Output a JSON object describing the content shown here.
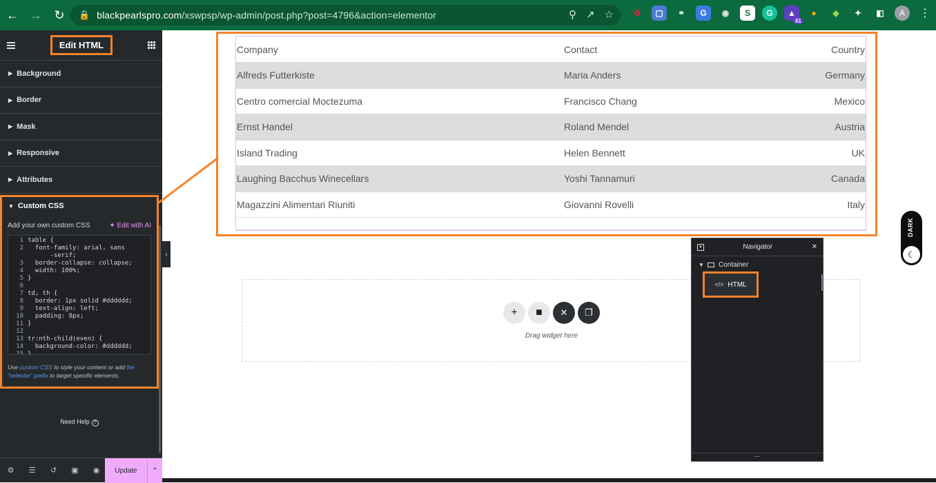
{
  "browser": {
    "url_host": "blackpearlspro.com",
    "url_path": "/xswpsp/wp-admin/post.php?post=4796&action=elementor",
    "extension_badge": "61",
    "avatar_letter": "A"
  },
  "panel": {
    "title": "Edit HTML",
    "sections": [
      "Background",
      "Border",
      "Mask",
      "Responsive",
      "Attributes"
    ],
    "custom_css": {
      "heading": "Custom CSS",
      "subtitle": "Add your own custom CSS",
      "ai_label": "Edit with AI",
      "code_lines": [
        {
          "n": "1",
          "t": "table {"
        },
        {
          "n": "2",
          "t": "  font-family: arial, sans"
        },
        {
          "n": "",
          "t": "      -serif;"
        },
        {
          "n": "3",
          "t": "  border-collapse: collapse;"
        },
        {
          "n": "4",
          "t": "  width: 100%;"
        },
        {
          "n": "5",
          "t": "}"
        },
        {
          "n": "6",
          "t": ""
        },
        {
          "n": "7",
          "t": "td, th {"
        },
        {
          "n": "8",
          "t": "  border: 1px solid #dddddd;"
        },
        {
          "n": "9",
          "t": "  text-align: left;"
        },
        {
          "n": "10",
          "t": "  padding: 8px;"
        },
        {
          "n": "11",
          "t": "}"
        },
        {
          "n": "12",
          "t": ""
        },
        {
          "n": "13",
          "t": "tr:nth-child(even) {"
        },
        {
          "n": "14",
          "t": "  background-color: #dddddd;"
        },
        {
          "n": "15",
          "t": "}"
        }
      ],
      "note_prefix": "Use ",
      "note_link1": "custom CSS",
      "note_mid": " to style your content or add ",
      "note_link2": "the \"selector\" prefix",
      "note_suffix": " to target specific elements."
    },
    "need_help": "Need Help",
    "update_label": "Update"
  },
  "table": {
    "headers": [
      "Company",
      "Contact",
      "Country"
    ],
    "rows": [
      [
        "Alfreds Futterkiste",
        "Maria Anders",
        "Germany"
      ],
      [
        "Centro comercial Moctezuma",
        "Francisco Chang",
        "Mexico"
      ],
      [
        "Ernst Handel",
        "Roland Mendel",
        "Austria"
      ],
      [
        "Island Trading",
        "Helen Bennett",
        "UK"
      ],
      [
        "Laughing Bacchus Winecellars",
        "Yoshi Tannamuri",
        "Canada"
      ],
      [
        "Magazzini Alimentari Riuniti",
        "Giovanni Rovelli",
        "Italy"
      ]
    ]
  },
  "dropzone": {
    "text": "Drag widget here"
  },
  "navigator": {
    "title": "Navigator",
    "container_label": "Container",
    "html_label": "HTML"
  },
  "dark_toggle": {
    "label": "DARK"
  },
  "colors": {
    "accent_orange": "#f5832a",
    "update_pink": "#f0abfc",
    "chrome_green": "#0b6b3f",
    "panel_dark": "#26292c"
  }
}
